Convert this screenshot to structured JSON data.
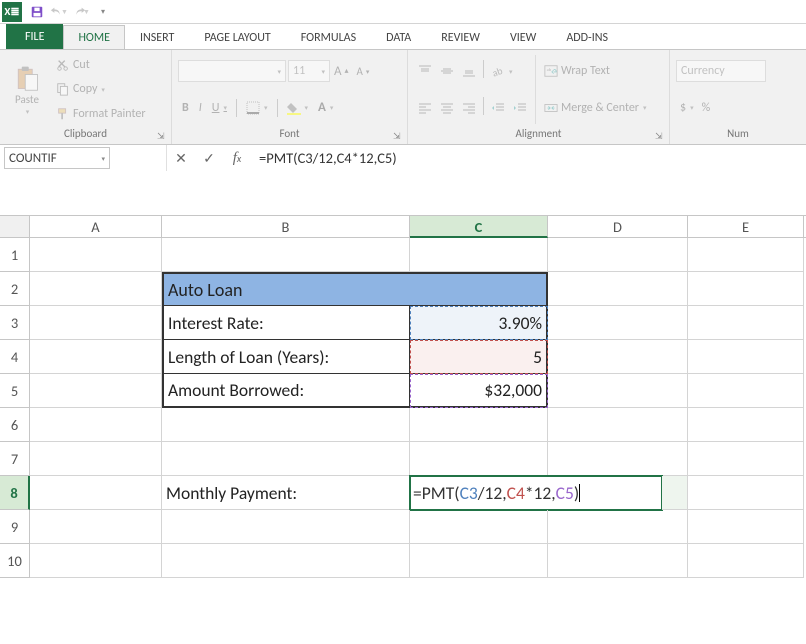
{
  "qat": {
    "save": "save-icon",
    "undo": "undo-icon",
    "redo": "redo-icon"
  },
  "tabs": {
    "file": "FILE",
    "home": "HOME",
    "insert": "INSERT",
    "page_layout": "PAGE LAYOUT",
    "formulas": "FORMULAS",
    "data": "DATA",
    "review": "REVIEW",
    "view": "VIEW",
    "addins": "ADD-INS"
  },
  "ribbon": {
    "clipboard": {
      "paste": "Paste",
      "cut": "Cut",
      "copy": "Copy",
      "format_painter": "Format Painter",
      "label": "Clipboard"
    },
    "font": {
      "name": "",
      "size": "11",
      "bold": "B",
      "italic": "I",
      "underline": "U",
      "label": "Font"
    },
    "alignment": {
      "wrap_text": "Wrap Text",
      "merge_center": "Merge & Center",
      "label": "Alignment"
    },
    "number": {
      "format": "Currency",
      "dollar": "$",
      "percent": "%",
      "label": "Num"
    }
  },
  "fxbar": {
    "name_box": "COUNTIF",
    "formula": "=PMT(C3/12,C4*12,C5)"
  },
  "columns": [
    "A",
    "B",
    "C",
    "D",
    "E"
  ],
  "rows": [
    "1",
    "2",
    "3",
    "4",
    "5",
    "6",
    "7",
    "8",
    "9",
    "10"
  ],
  "sheet": {
    "b2": "Auto Loan",
    "b3": "Interest Rate:",
    "c3": "3.90%",
    "b4": "Length of Loan (Years):",
    "c4": "5",
    "b5": "Amount Borrowed:",
    "c5": "$32,000",
    "b8": "Monthly Payment:",
    "c8_parts": {
      "eq": "=PMT(",
      "r1": "C3",
      "d1": "/12,",
      "r2": "C4",
      "d2": "*12,",
      "r3": "C5",
      "end": ")"
    }
  }
}
